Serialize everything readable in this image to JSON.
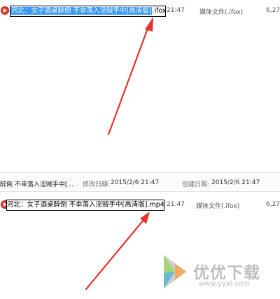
{
  "top_row": {
    "selected_name": "河北：女子酒桌醉倒 不幸落入淫贼手中[高清版]",
    "extension": ".ifox",
    "time": "21:47",
    "type": "媒体文件(.ifox)",
    "size": "6,27"
  },
  "details_bar": {
    "name": "醉倒 不幸落入淫贼手中[...",
    "modified_label": "修改日期:",
    "modified_value": "2015/2/6 21:47",
    "created_label": "创建日期:",
    "created_value": "2015/2/6 21:47"
  },
  "bottom_row": {
    "name": "河北：女子酒桌醉倒 不幸落入淫贼手中[高清版].mp4",
    "time": "21:47",
    "type": "媒体文件(.ifox)",
    "size": "6,27"
  },
  "watermark": {
    "text": "优优下载",
    "url": "www.yyxt.com"
  },
  "colors": {
    "selection": "#3399ff",
    "arrow": "#e8322a"
  },
  "icons": [
    "media-file-icon",
    "watermark-logo-icon"
  ]
}
